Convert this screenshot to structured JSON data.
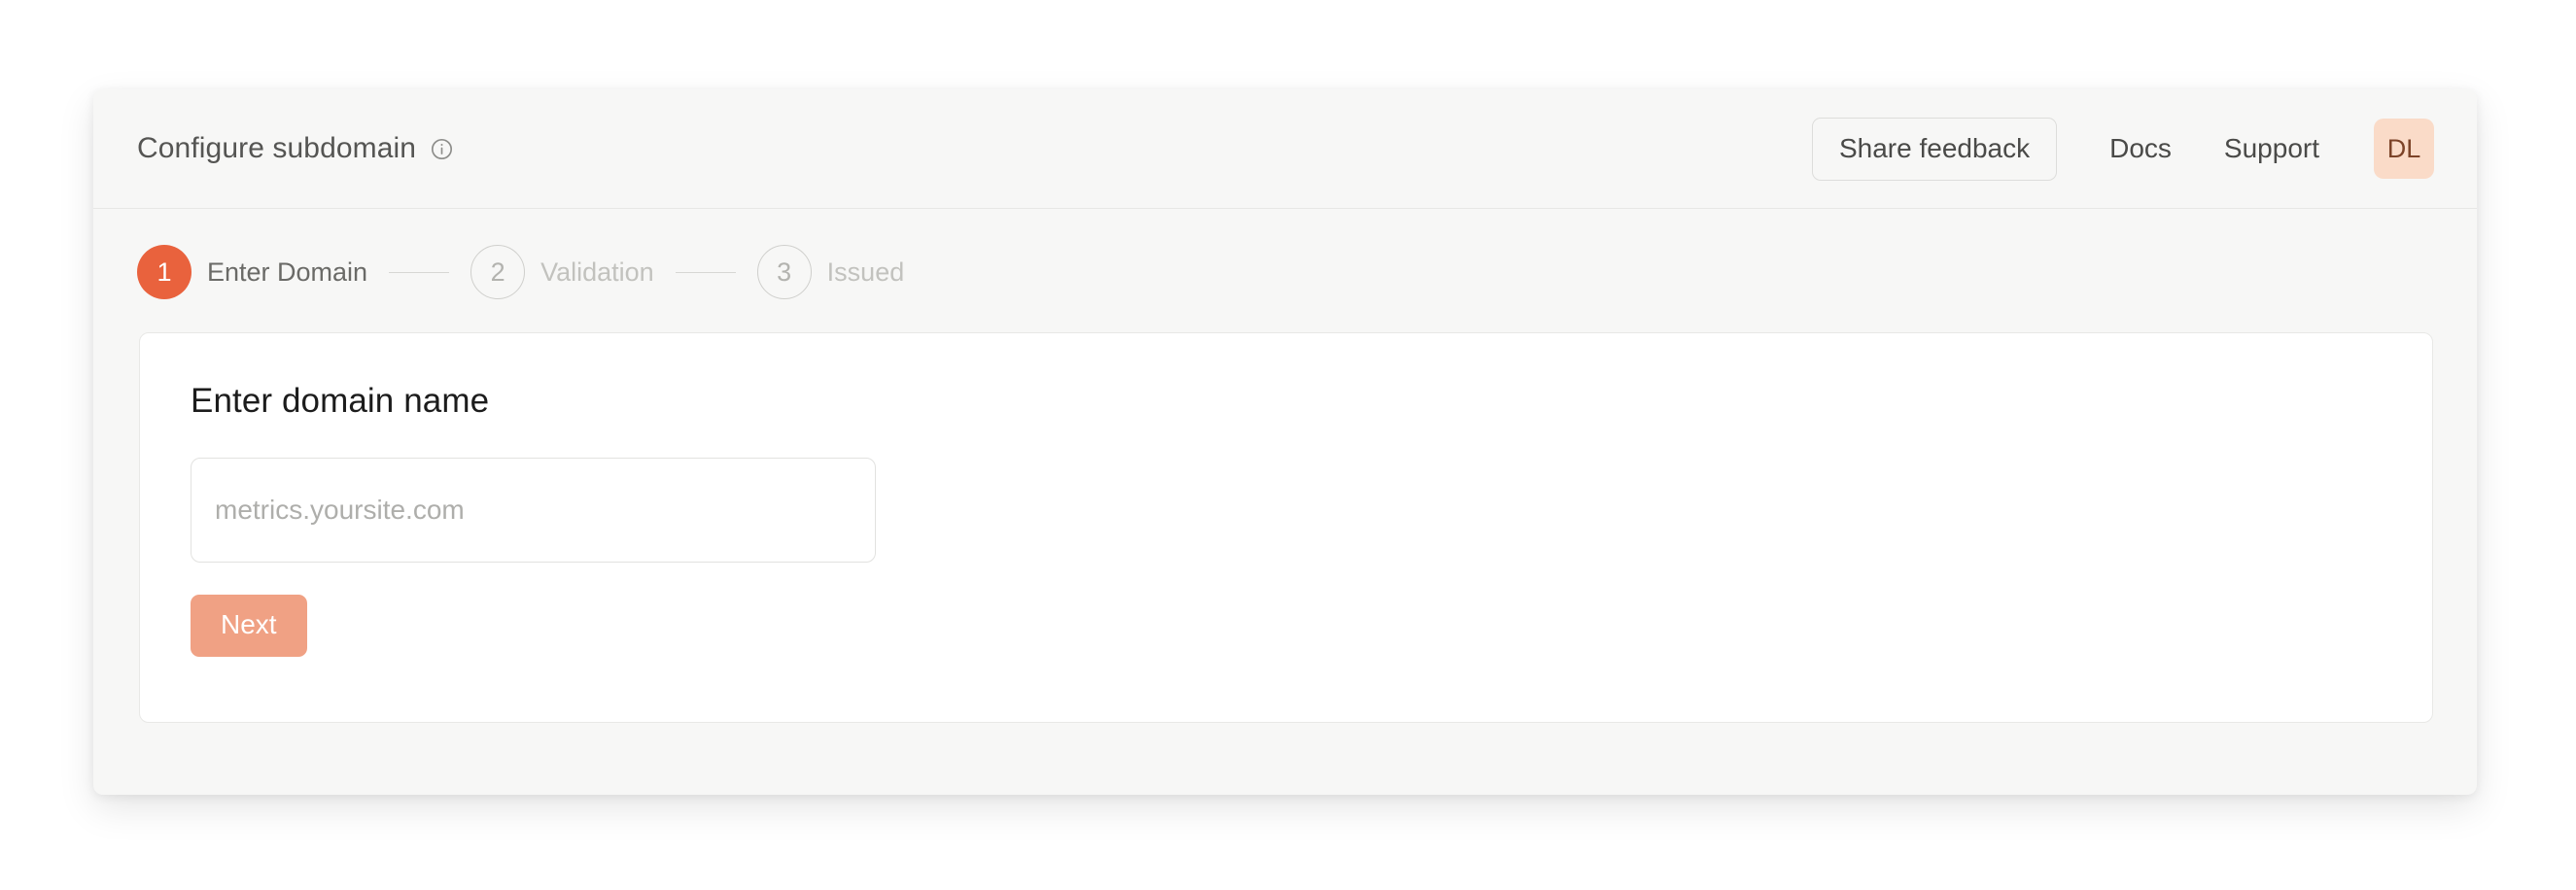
{
  "header": {
    "title": "Configure subdomain",
    "info_icon": "info-circle-icon",
    "share_feedback_label": "Share feedback",
    "docs_label": "Docs",
    "support_label": "Support",
    "avatar_initials": "DL"
  },
  "stepper": {
    "steps": [
      {
        "number": "1",
        "label": "Enter Domain",
        "state": "active"
      },
      {
        "number": "2",
        "label": "Validation",
        "state": "inactive"
      },
      {
        "number": "3",
        "label": "Issued",
        "state": "inactive"
      }
    ]
  },
  "main": {
    "heading": "Enter domain name",
    "domain_input": {
      "value": "",
      "placeholder": "metrics.yoursite.com"
    },
    "next_label": "Next"
  },
  "colors": {
    "accent": "#e9623d",
    "accent_disabled": "#f0a184",
    "avatar_bg": "#fadbc8",
    "avatar_text": "#7c4328",
    "window_bg": "#f7f7f6",
    "card_bg": "#ffffff",
    "border": "#e8e8e6"
  }
}
